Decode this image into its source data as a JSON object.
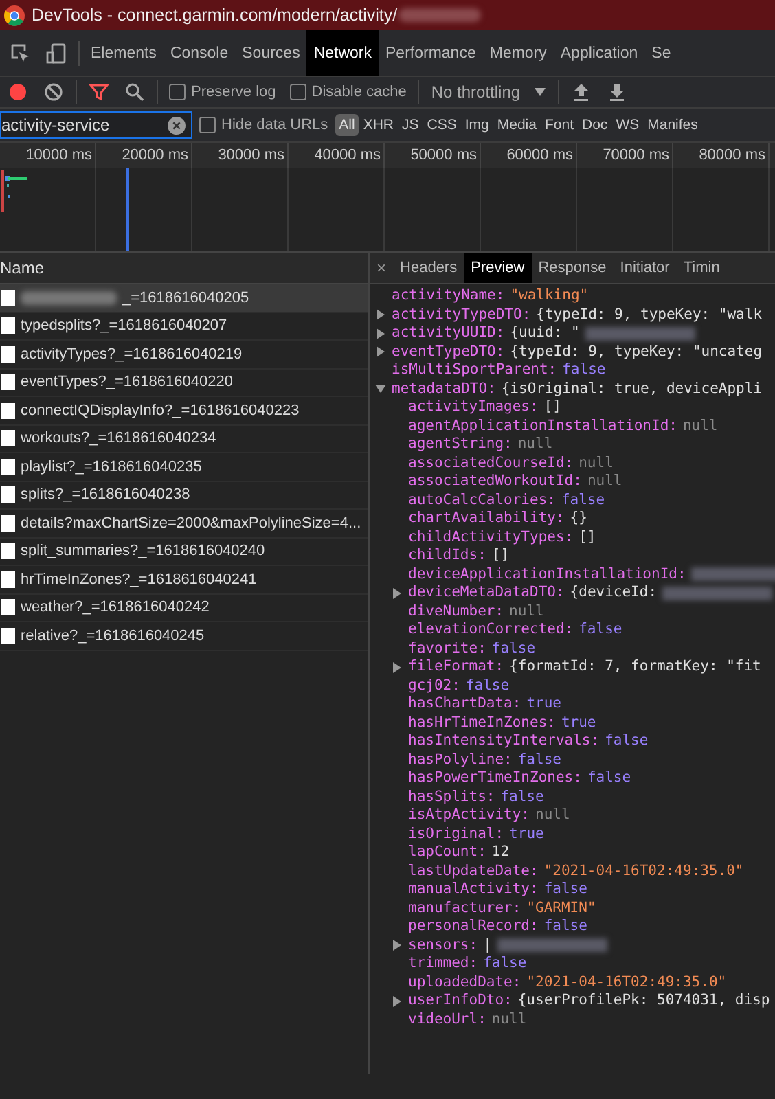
{
  "window": {
    "title": "DevTools - connect.garmin.com/modern/activity/",
    "title_redacted": true
  },
  "panel_tabs": [
    {
      "label": "Elements",
      "selected": false
    },
    {
      "label": "Console",
      "selected": false
    },
    {
      "label": "Sources",
      "selected": false
    },
    {
      "label": "Network",
      "selected": true
    },
    {
      "label": "Performance",
      "selected": false
    },
    {
      "label": "Memory",
      "selected": false
    },
    {
      "label": "Application",
      "selected": false
    },
    {
      "label": "Se",
      "selected": false
    }
  ],
  "toolbar": {
    "recording": true,
    "filter_active": true,
    "preserve_log": {
      "label": "Preserve log",
      "checked": false
    },
    "disable_cache": {
      "label": "Disable cache",
      "checked": false
    },
    "throttling": "No throttling"
  },
  "filter_bar": {
    "value": "activity-service",
    "hide_data_urls": {
      "label": "Hide data URLs",
      "checked": false
    },
    "types": [
      {
        "label": "All",
        "selected": true
      },
      {
        "label": "XHR",
        "selected": false
      },
      {
        "label": "JS",
        "selected": false
      },
      {
        "label": "CSS",
        "selected": false
      },
      {
        "label": "Img",
        "selected": false
      },
      {
        "label": "Media",
        "selected": false
      },
      {
        "label": "Font",
        "selected": false
      },
      {
        "label": "Doc",
        "selected": false
      },
      {
        "label": "WS",
        "selected": false
      },
      {
        "label": "Manifes",
        "selected": false
      }
    ]
  },
  "timeline": {
    "ticks": [
      "10000 ms",
      "20000 ms",
      "30000 ms",
      "40000 ms",
      "50000 ms",
      "60000 ms",
      "70000 ms",
      "80000 ms"
    ]
  },
  "requests": {
    "column": "Name",
    "rows": [
      {
        "name": "_=1618616040205",
        "redacted": true,
        "selected": true
      },
      {
        "name": "typedsplits?_=1618616040207",
        "redacted": false,
        "selected": false
      },
      {
        "name": "activityTypes?_=1618616040219",
        "redacted": false,
        "selected": false
      },
      {
        "name": "eventTypes?_=1618616040220",
        "redacted": false,
        "selected": false
      },
      {
        "name": "connectIQDisplayInfo?_=1618616040223",
        "redacted": false,
        "selected": false
      },
      {
        "name": "workouts?_=1618616040234",
        "redacted": false,
        "selected": false
      },
      {
        "name": "playlist?_=1618616040235",
        "redacted": false,
        "selected": false
      },
      {
        "name": "splits?_=1618616040238",
        "redacted": false,
        "selected": false
      },
      {
        "name": "details?maxChartSize=2000&maxPolylineSize=4...",
        "redacted": false,
        "selected": false
      },
      {
        "name": "split_summaries?_=1618616040240",
        "redacted": false,
        "selected": false
      },
      {
        "name": "hrTimeInZones?_=1618616040241",
        "redacted": false,
        "selected": false
      },
      {
        "name": "weather?_=1618616040242",
        "redacted": false,
        "selected": false
      },
      {
        "name": "relative?_=1618616040245",
        "redacted": false,
        "selected": false
      }
    ]
  },
  "detail_tabs": {
    "close": "×",
    "tabs": [
      {
        "label": "Headers",
        "selected": false
      },
      {
        "label": "Preview",
        "selected": true
      },
      {
        "label": "Response",
        "selected": false
      },
      {
        "label": "Initiator",
        "selected": false
      },
      {
        "label": "Timin",
        "selected": false
      }
    ]
  },
  "preview": [
    {
      "key": "activityName:",
      "value": "\"walking\"",
      "kind": "string"
    },
    {
      "key": "activityTypeDTO:",
      "value": "{typeId: 9, typeKey: \"walk",
      "kind": "object",
      "expanded": false
    },
    {
      "key": "activityUUID:",
      "value": "{uuid: \"",
      "kind": "object",
      "expanded": false,
      "redacted": true
    },
    {
      "key": "eventTypeDTO:",
      "value": "{typeId: 9, typeKey: \"uncateg",
      "kind": "object",
      "expanded": false
    },
    {
      "key": "isMultiSportParent:",
      "value": "false",
      "kind": "bool"
    },
    {
      "key": "metadataDTO:",
      "value": "{isOriginal: true, deviceAppli",
      "kind": "object",
      "expanded": true,
      "children": [
        {
          "key": "activityImages:",
          "value": "[]",
          "kind": "array"
        },
        {
          "key": "agentApplicationInstallationId:",
          "value": "null",
          "kind": "null"
        },
        {
          "key": "agentString:",
          "value": "null",
          "kind": "null"
        },
        {
          "key": "associatedCourseId:",
          "value": "null",
          "kind": "null"
        },
        {
          "key": "associatedWorkoutId:",
          "value": "null",
          "kind": "null"
        },
        {
          "key": "autoCalcCalories:",
          "value": "false",
          "kind": "bool"
        },
        {
          "key": "chartAvailability:",
          "value": "{}",
          "kind": "array"
        },
        {
          "key": "childActivityTypes:",
          "value": "[]",
          "kind": "array"
        },
        {
          "key": "childIds:",
          "value": "[]",
          "kind": "array"
        },
        {
          "key": "deviceApplicationInstallationId:",
          "kind": "null",
          "redacted": true
        },
        {
          "key": "deviceMetaDataDTO:",
          "value": "{deviceId:",
          "kind": "object",
          "expanded": false,
          "redacted": true
        },
        {
          "key": "diveNumber:",
          "value": "null",
          "kind": "null"
        },
        {
          "key": "elevationCorrected:",
          "value": "false",
          "kind": "bool"
        },
        {
          "key": "favorite:",
          "value": "false",
          "kind": "bool"
        },
        {
          "key": "fileFormat:",
          "value": "{formatId: 7, formatKey: \"fit",
          "kind": "object",
          "expanded": false
        },
        {
          "key": "gcj02:",
          "value": "false",
          "kind": "bool"
        },
        {
          "key": "hasChartData:",
          "value": "true",
          "kind": "bool"
        },
        {
          "key": "hasHrTimeInZones:",
          "value": "true",
          "kind": "bool"
        },
        {
          "key": "hasIntensityIntervals:",
          "value": "false",
          "kind": "bool"
        },
        {
          "key": "hasPolyline:",
          "value": "false",
          "kind": "bool"
        },
        {
          "key": "hasPowerTimeInZones:",
          "value": "false",
          "kind": "bool"
        },
        {
          "key": "hasSplits:",
          "value": "false",
          "kind": "bool"
        },
        {
          "key": "isAtpActivity:",
          "value": "null",
          "kind": "null"
        },
        {
          "key": "isOriginal:",
          "value": "true",
          "kind": "bool"
        },
        {
          "key": "lapCount:",
          "value": "12",
          "kind": "number"
        },
        {
          "key": "lastUpdateDate:",
          "value": "\"2021-04-16T02:49:35.0\"",
          "kind": "string"
        },
        {
          "key": "manualActivity:",
          "value": "false",
          "kind": "bool"
        },
        {
          "key": "manufacturer:",
          "value": "\"GARMIN\"",
          "kind": "string"
        },
        {
          "key": "personalRecord:",
          "value": "false",
          "kind": "bool"
        },
        {
          "key": "sensors:",
          "value": "|",
          "kind": "object",
          "expanded": false,
          "redacted": true
        },
        {
          "key": "trimmed:",
          "value": "false",
          "kind": "bool"
        },
        {
          "key": "uploadedDate:",
          "value": "\"2021-04-16T02:49:35.0\"",
          "kind": "string"
        },
        {
          "key": "userInfoDto:",
          "value": "{userProfilePk: 5074031, disp",
          "kind": "object",
          "expanded": false
        },
        {
          "key": "videoUrl:",
          "value": "null",
          "kind": "null"
        }
      ]
    }
  ]
}
